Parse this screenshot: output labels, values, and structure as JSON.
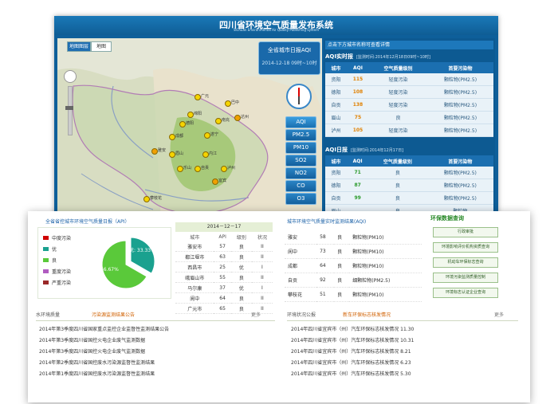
{
  "header": {
    "title": "四川省环境空气质量发布系统",
    "subtitle": "SiChuan Environmental Air Quality Publishing System"
  },
  "map": {
    "tabs": [
      "地图图层",
      "地图"
    ],
    "aqi_label": "全省城市日报AQI",
    "aqi_time": "2014-12-18 09时~10时",
    "pollutant_buttons": [
      "AQI",
      "PM2.5",
      "PM10",
      "SO2",
      "NO2",
      "CO",
      "O3"
    ],
    "cities": [
      {
        "name": "广元",
        "color": "#f5d400"
      },
      {
        "name": "巴中",
        "color": "#f5d400"
      },
      {
        "name": "绵阳",
        "color": "#f5d400"
      },
      {
        "name": "德阳",
        "color": "#f5d400"
      },
      {
        "name": "南充",
        "color": "#f5d400"
      },
      {
        "name": "达州",
        "color": "#f0a000"
      },
      {
        "name": "成都",
        "color": "#f5d400"
      },
      {
        "name": "遂宁",
        "color": "#f5d400"
      },
      {
        "name": "雅安",
        "color": "#f0a000"
      },
      {
        "name": "眉山",
        "color": "#f5d400"
      },
      {
        "name": "内江",
        "color": "#f5d400"
      },
      {
        "name": "乐山",
        "color": "#f5d400"
      },
      {
        "name": "自贡",
        "color": "#f5d400"
      },
      {
        "name": "宜宾",
        "color": "#f0a000"
      },
      {
        "name": "泸州",
        "color": "#f5d400"
      },
      {
        "name": "攀枝花",
        "color": "#f5d400"
      }
    ]
  },
  "right_panel": {
    "notice": "点击下方城市名称可查看详情",
    "realtime": {
      "title": "AQI实时报",
      "time": "[监测时间:2014年12月18日09时~10时]",
      "headers": [
        "城市",
        "AQI",
        "空气质量级别",
        "首要污染物"
      ],
      "rows": [
        [
          "资阳",
          "115",
          "轻度污染",
          "颗粒物(PM2.5)"
        ],
        [
          "德阳",
          "108",
          "轻度污染",
          "颗粒物(PM2.5)"
        ],
        [
          "自贡",
          "138",
          "轻度污染",
          "颗粒物(PM2.5)"
        ],
        [
          "眉山",
          "75",
          "良",
          "颗粒物(PM2.5)"
        ],
        [
          "泸州",
          "105",
          "轻度污染",
          "颗粒物(PM2.5)"
        ]
      ]
    },
    "daily": {
      "title": "AQI日报",
      "time": "[监测时间:2014年12月17日]",
      "headers": [
        "城市",
        "AQI",
        "空气质量级别",
        "首要污染物"
      ],
      "rows": [
        [
          "资阳",
          "71",
          "良",
          "颗粒物(PM2.5)"
        ],
        [
          "德阳",
          "87",
          "良",
          "颗粒物(PM2.5)"
        ],
        [
          "自贡",
          "99",
          "良",
          "颗粒物(PM2.5)"
        ],
        [
          "眉山",
          "",
          "良",
          "颗粒物"
        ]
      ]
    }
  },
  "pie": {
    "title": "全省省控城市环境空气质量日报（API）",
    "legend": [
      "中度污染",
      "优",
      "良",
      "重度污染",
      "严重污染"
    ],
    "legend_colors": [
      "#d00000",
      "#1aa18f",
      "#5ac93a",
      "#b05cc0",
      "#9a2828"
    ],
    "label_a": "优: 33.33%",
    "label_b": "良: 66.67%"
  },
  "api_table": {
    "date": "2014－12－17",
    "headers": [
      "城市",
      "API",
      "级别",
      "状况"
    ],
    "rows": [
      [
        "雅安市",
        "57",
        "良",
        "II"
      ],
      [
        "都江堰市",
        "63",
        "良",
        "II"
      ],
      [
        "西昌市",
        "25",
        "优",
        "I"
      ],
      [
        "峨眉山市",
        "55",
        "良",
        "II"
      ],
      [
        "马尔康",
        "37",
        "优",
        "I"
      ],
      [
        "阆中",
        "64",
        "良",
        "II"
      ],
      [
        "广元市",
        "65",
        "良",
        "II"
      ]
    ]
  },
  "city_aqi": {
    "title": "城市环境空气质量实时监测结果(AQI)",
    "rows": [
      [
        "雅安",
        "58",
        "良",
        "颗粒物(PM10)"
      ],
      [
        "阆中",
        "73",
        "良",
        "颗粒物(PM10)"
      ],
      [
        "成都",
        "64",
        "良",
        "颗粒物(PM10)"
      ],
      [
        "自贡",
        "92",
        "良",
        "细颗粒物(PM2.5)"
      ],
      [
        "攀枝花",
        "51",
        "良",
        "颗粒物(PM10)"
      ]
    ]
  },
  "service": {
    "title": "环保数据查询",
    "buttons": [
      "行政审批",
      "环境影响评价机构资质查询",
      "机动车环保标志查询",
      "环境污染监测质量控制",
      "环境标志认证企业查询"
    ]
  },
  "news_left": {
    "tabs": [
      "水环境质量",
      "污染源监测结果公告"
    ],
    "more": "更多",
    "items": [
      "2014年第3季度四川省国家重点监控企业监督性监测结果公告",
      "2014年第3季度四川省国控火电企业废气监测数据",
      "2014年第3季度四川省国控火电企业废气监测数据",
      "2014年第2季度四川省国控废水污染源监督性监测结果",
      "2014年第1季度四川省国控废水污染源监督性监测结果"
    ]
  },
  "news_right": {
    "tabs": [
      "环境状况公报",
      "新车环保标志核发情况"
    ],
    "more": "更多",
    "items": [
      "2014年四川省宜宾市（州）汽车环保标志核发情况 11.30",
      "2014年四川省宜宾市（州）汽车环保标志核发情况 10.31",
      "2014年四川省宜宾市（州）汽车环保标志核发情况 8.21",
      "2014年四川省宜宾市（州）汽车环保标志核发情况 6.23",
      "2014年四川省宜宾市（州）汽车环保标志核发情况 5.30"
    ]
  }
}
